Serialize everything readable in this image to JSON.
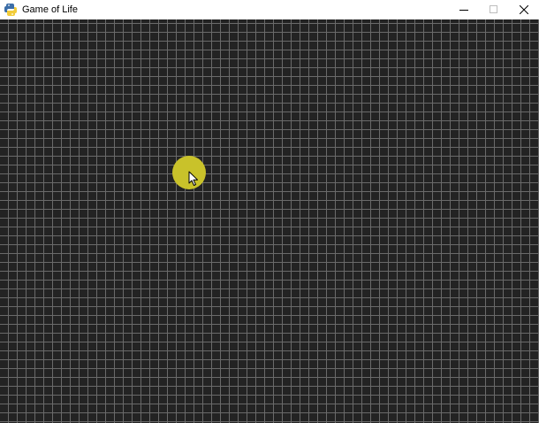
{
  "window": {
    "title": "Game of Life",
    "icon": "python-icon",
    "controls": {
      "minimize": "minimize-icon",
      "maximize": "maximize-icon",
      "close": "close-icon"
    }
  },
  "board": {
    "background": "#232323",
    "grid_line_color": "#6a6a6a",
    "live_cells": []
  },
  "cursor": {
    "highlight_color": "#c9c22a",
    "icon": "arrow-pointer-icon"
  }
}
